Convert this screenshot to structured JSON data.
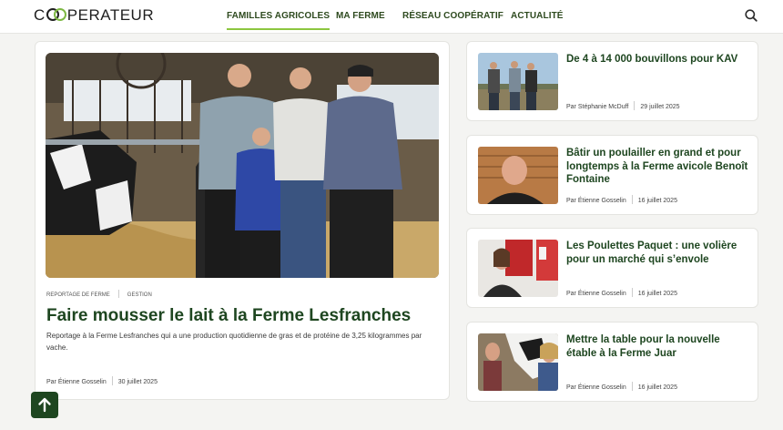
{
  "brand": {
    "pre": "C",
    "post": "PERATEUR"
  },
  "nav": [
    {
      "label": "FAMILLES AGRICOLES"
    },
    {
      "label": "MA FERME"
    },
    {
      "label": "RÉSEAU COOPÉRATIF"
    },
    {
      "label": "ACTUALITÉ"
    }
  ],
  "search": {
    "icon": "search-icon"
  },
  "featured": {
    "tags": [
      "REPORTAGE DE FERME",
      "GESTION"
    ],
    "title": "Faire mousser le lait à la Ferme Lesfranches",
    "description": "Reportage à la Ferme Lesfranches qui a une production quotidienne de gras et de protéine de 3,25 kilogrammes par vache.",
    "author": "Par Étienne Gosselin",
    "date": "30 juillet 2025"
  },
  "articles": [
    {
      "title": "De 4 à 14 000 bouvillons pour KAV",
      "author": "Par Stéphanie McDuff",
      "date": "29 juillet 2025"
    },
    {
      "title": "Bâtir un poulailler en grand et pour longtemps à la Ferme avicole Benoît Fontaine",
      "author": "Par Étienne Gosselin",
      "date": "16 juillet 2025"
    },
    {
      "title": "Les Poulettes Paquet : une volière pour un marché qui s’envole",
      "author": "Par Étienne Gosselin",
      "date": "16 juillet 2025"
    },
    {
      "title": "Mettre la table pour la nouvelle étable à la Ferme Juar",
      "author": "Par Étienne Gosselin",
      "date": "16 juillet 2025"
    }
  ],
  "colors": {
    "brand_green": "#1e4620",
    "accent": "#8cc63f"
  },
  "scroll_top": {
    "icon": "arrow-up-icon"
  }
}
